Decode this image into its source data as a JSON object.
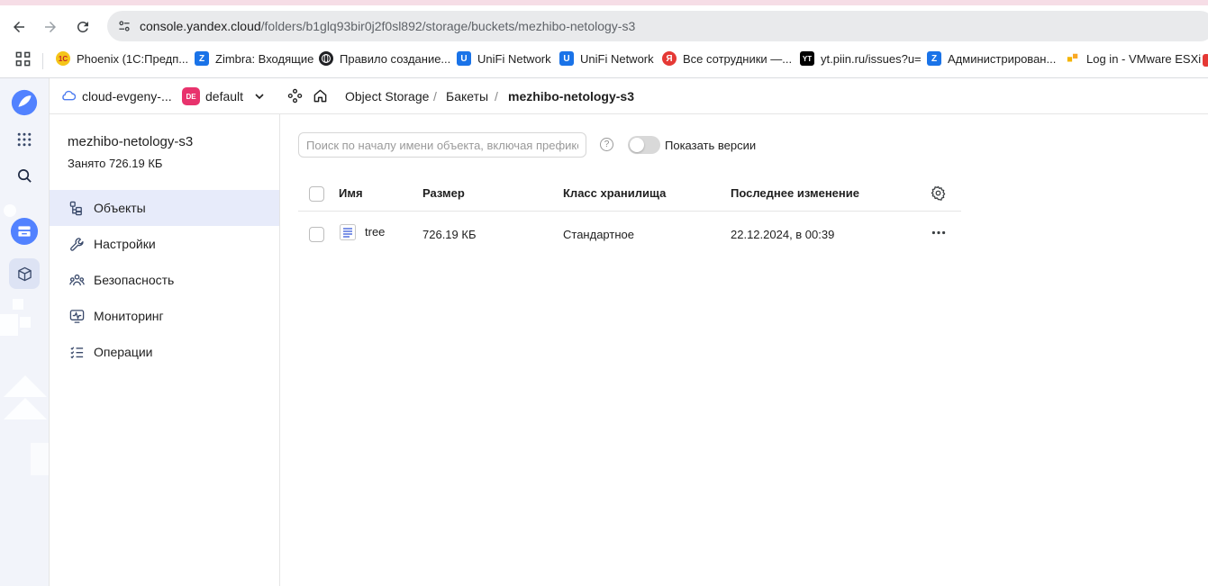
{
  "browser": {
    "url_domain": "console.yandex.cloud",
    "url_path": "/folders/b1glq93bir0j2f0sl892/storage/buckets/mezhibo-netology-s3",
    "bookmarks": [
      {
        "label": "Phoenix (1С:Предп...",
        "icon": "1c-icon",
        "color": "#f5c518"
      },
      {
        "label": "Zimbra: Входящие",
        "icon": "zimbra-icon",
        "color": "#1a73e8"
      },
      {
        "label": "Правило создание...",
        "icon": "globe-icon",
        "color": "#202124"
      },
      {
        "label": "UniFi Network",
        "icon": "unifi-icon",
        "color": "#1a73e8"
      },
      {
        "label": "UniFi Network",
        "icon": "unifi-icon",
        "color": "#1a73e8"
      },
      {
        "label": "Все сотрудники —...",
        "icon": "yandex-icon",
        "color": "#e53935"
      },
      {
        "label": "yt.piin.ru/issues?u=",
        "icon": "youtrack-icon",
        "color": "#000000"
      },
      {
        "label": "Администрирован...",
        "icon": "zimbra-icon",
        "color": "#1a73e8"
      },
      {
        "label": "Log in - VMware ESXi",
        "icon": "vmware-icon",
        "color": "#f4b400"
      }
    ]
  },
  "breadcrumbs": {
    "cloud": "cloud-evgeny-...",
    "folder_badge": "DE",
    "folder": "default",
    "service": "Object Storage",
    "section": "Бакеты",
    "separator": "/",
    "current": "mezhibo-netology-s3"
  },
  "bucket": {
    "name": "mezhibo-netology-s3",
    "used": "Занято 726.19 КБ"
  },
  "nav": [
    {
      "label": "Объекты",
      "icon": "objects-icon",
      "active": true
    },
    {
      "label": "Настройки",
      "icon": "wrench-icon",
      "active": false
    },
    {
      "label": "Безопасность",
      "icon": "users-icon",
      "active": false
    },
    {
      "label": "Мониторинг",
      "icon": "monitor-icon",
      "active": false
    },
    {
      "label": "Операции",
      "icon": "list-icon",
      "active": false
    }
  ],
  "toolbar": {
    "search_placeholder": "Поиск по началу имени объекта, включая префикс",
    "help": "?",
    "show_versions": "Показать версии",
    "show_versions_on": false
  },
  "table": {
    "columns": [
      "Имя",
      "Размер",
      "Класс хранилища",
      "Последнее изменение"
    ],
    "rows": [
      {
        "name": "tree",
        "size": "726.19 КБ",
        "storage_class": "Стандартное",
        "modified": "22.12.2024, в 00:39"
      }
    ]
  },
  "colors": {
    "accent": "#e7ebfa",
    "folder_badge": "#e8336d",
    "rail": "#f2f4fa"
  }
}
